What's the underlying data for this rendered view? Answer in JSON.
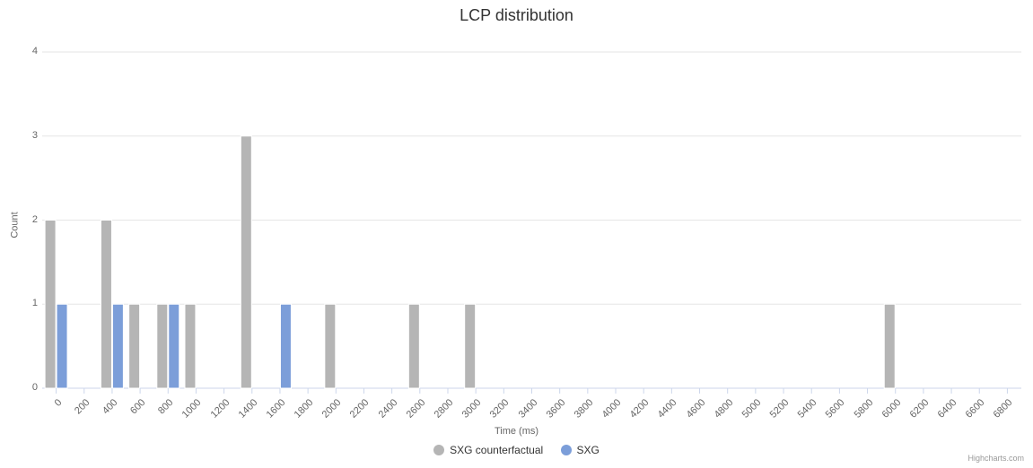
{
  "chart_data": {
    "type": "bar",
    "title": "LCP distribution",
    "xlabel": "Time (ms)",
    "ylabel": "Count",
    "ylim": [
      0,
      4
    ],
    "categories": [
      0,
      200,
      400,
      600,
      800,
      1000,
      1200,
      1400,
      1600,
      1800,
      2000,
      2200,
      2400,
      2600,
      2800,
      3000,
      3200,
      3400,
      3600,
      3800,
      4000,
      4200,
      4400,
      4600,
      4800,
      5000,
      5200,
      5400,
      5600,
      5800,
      6000,
      6200,
      6400,
      6600,
      6800
    ],
    "series": [
      {
        "name": "SXG counterfactual",
        "color": "#b5b5b5",
        "values": [
          2,
          0,
          2,
          1,
          1,
          1,
          0,
          3,
          0,
          0,
          1,
          0,
          0,
          1,
          0,
          1,
          0,
          0,
          0,
          0,
          0,
          0,
          0,
          0,
          0,
          0,
          0,
          0,
          0,
          0,
          1,
          0,
          0,
          0,
          0
        ]
      },
      {
        "name": "SXG",
        "color": "#7c9ed9",
        "values": [
          1,
          0,
          1,
          0,
          1,
          0,
          0,
          0,
          1,
          0,
          0,
          0,
          0,
          0,
          0,
          0,
          0,
          0,
          0,
          0,
          0,
          0,
          0,
          0,
          0,
          0,
          0,
          0,
          0,
          0,
          0,
          0,
          0,
          0,
          0
        ]
      }
    ],
    "credits": "Highcharts.com"
  }
}
